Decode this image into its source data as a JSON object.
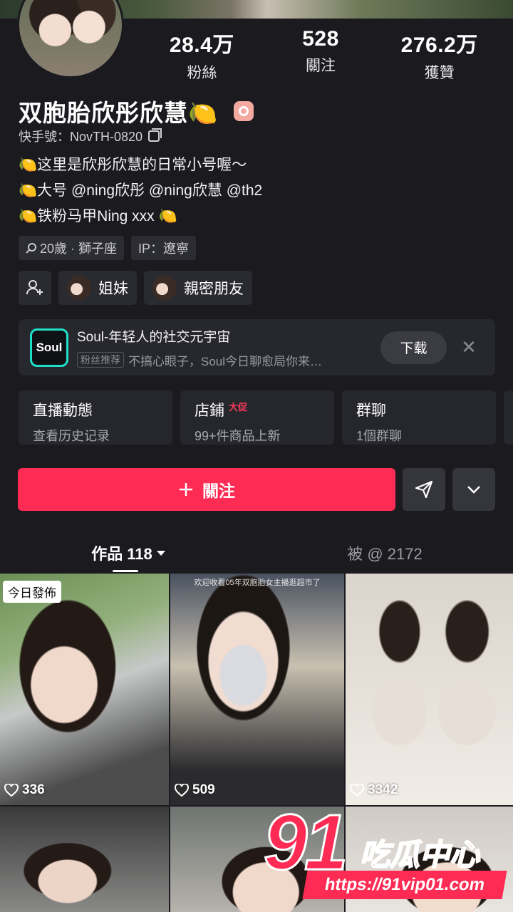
{
  "profile": {
    "name": "双胞胎欣彤欣慧🍋",
    "kuaishou_id": "快手號：NovTH-0820",
    "bio": [
      "🍋这里是欣彤欣慧的日常小号喔～",
      "🍋大号 @ning欣彤 @ning欣慧 @th2",
      "🍋铁粉马甲Ning xxx 🍋"
    ],
    "tags": [
      "20歲 · 獅子座",
      "IP：遼寧"
    ]
  },
  "stats": [
    {
      "value": "28.4万",
      "label": "粉絲"
    },
    {
      "value": "528",
      "label": "關注"
    },
    {
      "value": "276.2万",
      "label": "獲贊"
    }
  ],
  "relations": {
    "sister": "姐妹",
    "close_friend": "親密朋友"
  },
  "ad": {
    "title": "Soul-年轻人的社交元宇宙",
    "tag": "粉丝推荐",
    "subtitle": "不搞心眼子，Soul今日聊愈局你来…",
    "logo_text": "Soul",
    "download": "下载",
    "close": "✕"
  },
  "cards": [
    {
      "title": "直播動態",
      "sub": "查看历史记录",
      "hot": ""
    },
    {
      "title": "店鋪",
      "sub": "99+件商品上新",
      "hot": "大促"
    },
    {
      "title": "群聊",
      "sub": "1個群聊",
      "hot": ""
    }
  ],
  "follow_button": "關注",
  "tabs": {
    "works": "作品 118",
    "mentioned": "被 @ 2172"
  },
  "videos": [
    {
      "likes": "336",
      "badge": "今日發佈",
      "caption": ""
    },
    {
      "likes": "509",
      "badge": "",
      "caption": "欢迎收看05年双胞胎女主播逛超市了"
    },
    {
      "likes": "3342",
      "badge": "",
      "caption": ""
    }
  ],
  "watermark": {
    "big": "91",
    "text": "吃瓜中心",
    "url": "https://91vip01.com"
  },
  "colors": {
    "accent": "#fe2c55",
    "background": "#1a1a1f",
    "card": "#26262d",
    "soul": "#1ee0c8"
  }
}
